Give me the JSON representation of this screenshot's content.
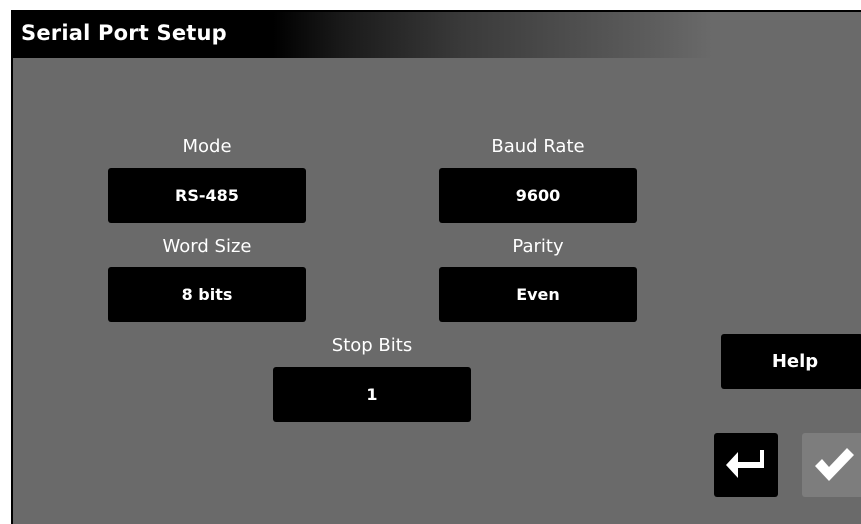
{
  "header": {
    "title": "Serial Port Setup"
  },
  "fields": [
    {
      "label": "Mode",
      "value": "RS-485"
    },
    {
      "label": "Baud Rate",
      "value": "9600"
    },
    {
      "label": "Word Size",
      "value": "8 bits"
    },
    {
      "label": "Parity",
      "value": "Even"
    },
    {
      "label": "Stop Bits",
      "value": "1"
    }
  ],
  "buttons": {
    "help_label": "Help",
    "back_icon": "return-arrow-icon",
    "confirm_icon": "checkmark-icon"
  },
  "colors": {
    "background": "#6a6a6a",
    "box": "#000000",
    "confirm_disabled": "#7d7d7d",
    "text": "#ffffff"
  }
}
